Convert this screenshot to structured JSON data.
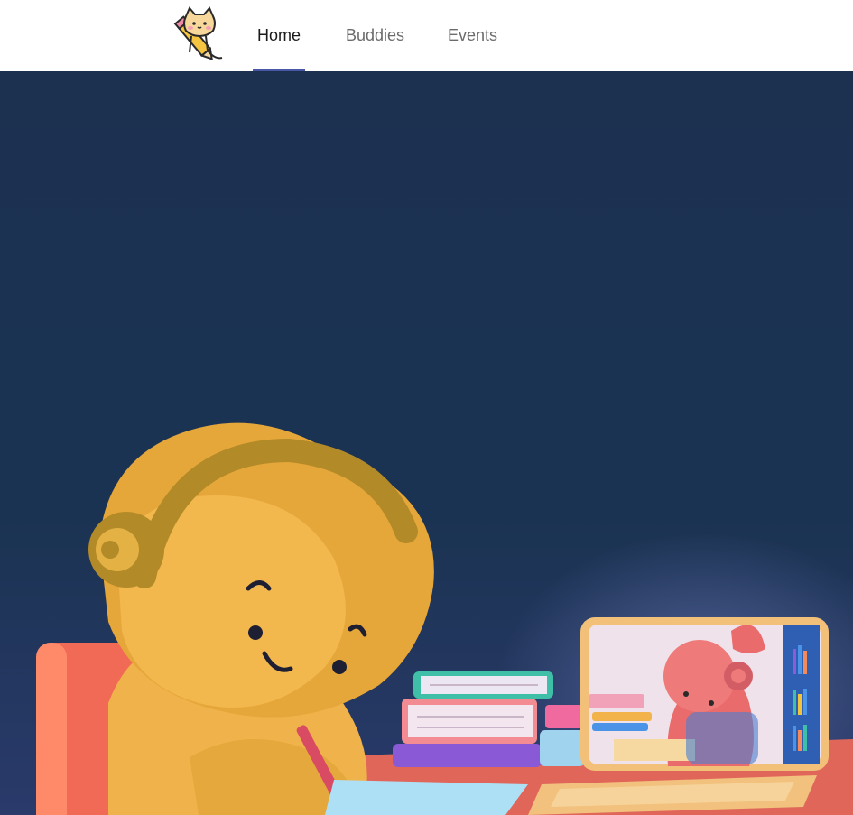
{
  "nav": {
    "tabs": [
      {
        "label": "Home",
        "active": true
      },
      {
        "label": "Buddies",
        "active": false
      },
      {
        "label": "Events",
        "active": false
      }
    ],
    "accent_color": "#4a56a6"
  },
  "hero": {
    "background_color": "#1b3150",
    "illustration": "child-studying-with-headphones-and-video-call-laptop"
  },
  "icons": {
    "logo": "cat-holding-pencil-icon"
  }
}
